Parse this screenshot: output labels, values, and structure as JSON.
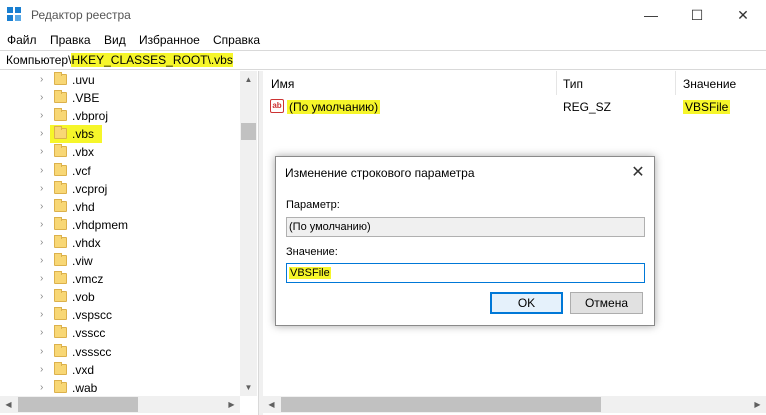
{
  "window": {
    "title": "Редактор реестра",
    "minimize_glyph": "—",
    "maximize_glyph": "☐",
    "close_glyph": "✕"
  },
  "menu": [
    "Файл",
    "Правка",
    "Вид",
    "Избранное",
    "Справка"
  ],
  "address": {
    "prefix": "Компьютер\\",
    "path": "HKEY_CLASSES_ROOT\\.vbs"
  },
  "tree": {
    "items": [
      ".uvu",
      ".VBE",
      ".vbproj",
      ".vbs",
      ".vbx",
      ".vcf",
      ".vcproj",
      ".vhd",
      ".vhdpmem",
      ".vhdx",
      ".viw",
      ".vmcz",
      ".vob",
      ".vspscc",
      ".vsscc",
      ".vssscc",
      ".vxd",
      ".wab"
    ],
    "selected": ".vbs"
  },
  "list": {
    "columns": [
      "Имя",
      "Тип",
      "Значение"
    ],
    "rows": [
      {
        "name": "(По умолчанию)",
        "type": "REG_SZ",
        "value": "VBSFile",
        "icon": "string-value-icon"
      }
    ]
  },
  "dialog": {
    "title": "Изменение строкового параметра",
    "param_label": "Параметр:",
    "param_value": "(По умолчанию)",
    "value_label": "Значение:",
    "value_input": "VBSFile",
    "ok_label": "OK",
    "cancel_label": "Отмена"
  },
  "colors": {
    "highlight": "#f6f62a",
    "accent": "#0078d7",
    "folder": "#f8d775"
  },
  "icons": [
    "registry-app-icon",
    "folder-icon",
    "chevron-right-icon",
    "string-value-icon",
    "close-icon",
    "minimize-icon",
    "maximize-icon"
  ]
}
